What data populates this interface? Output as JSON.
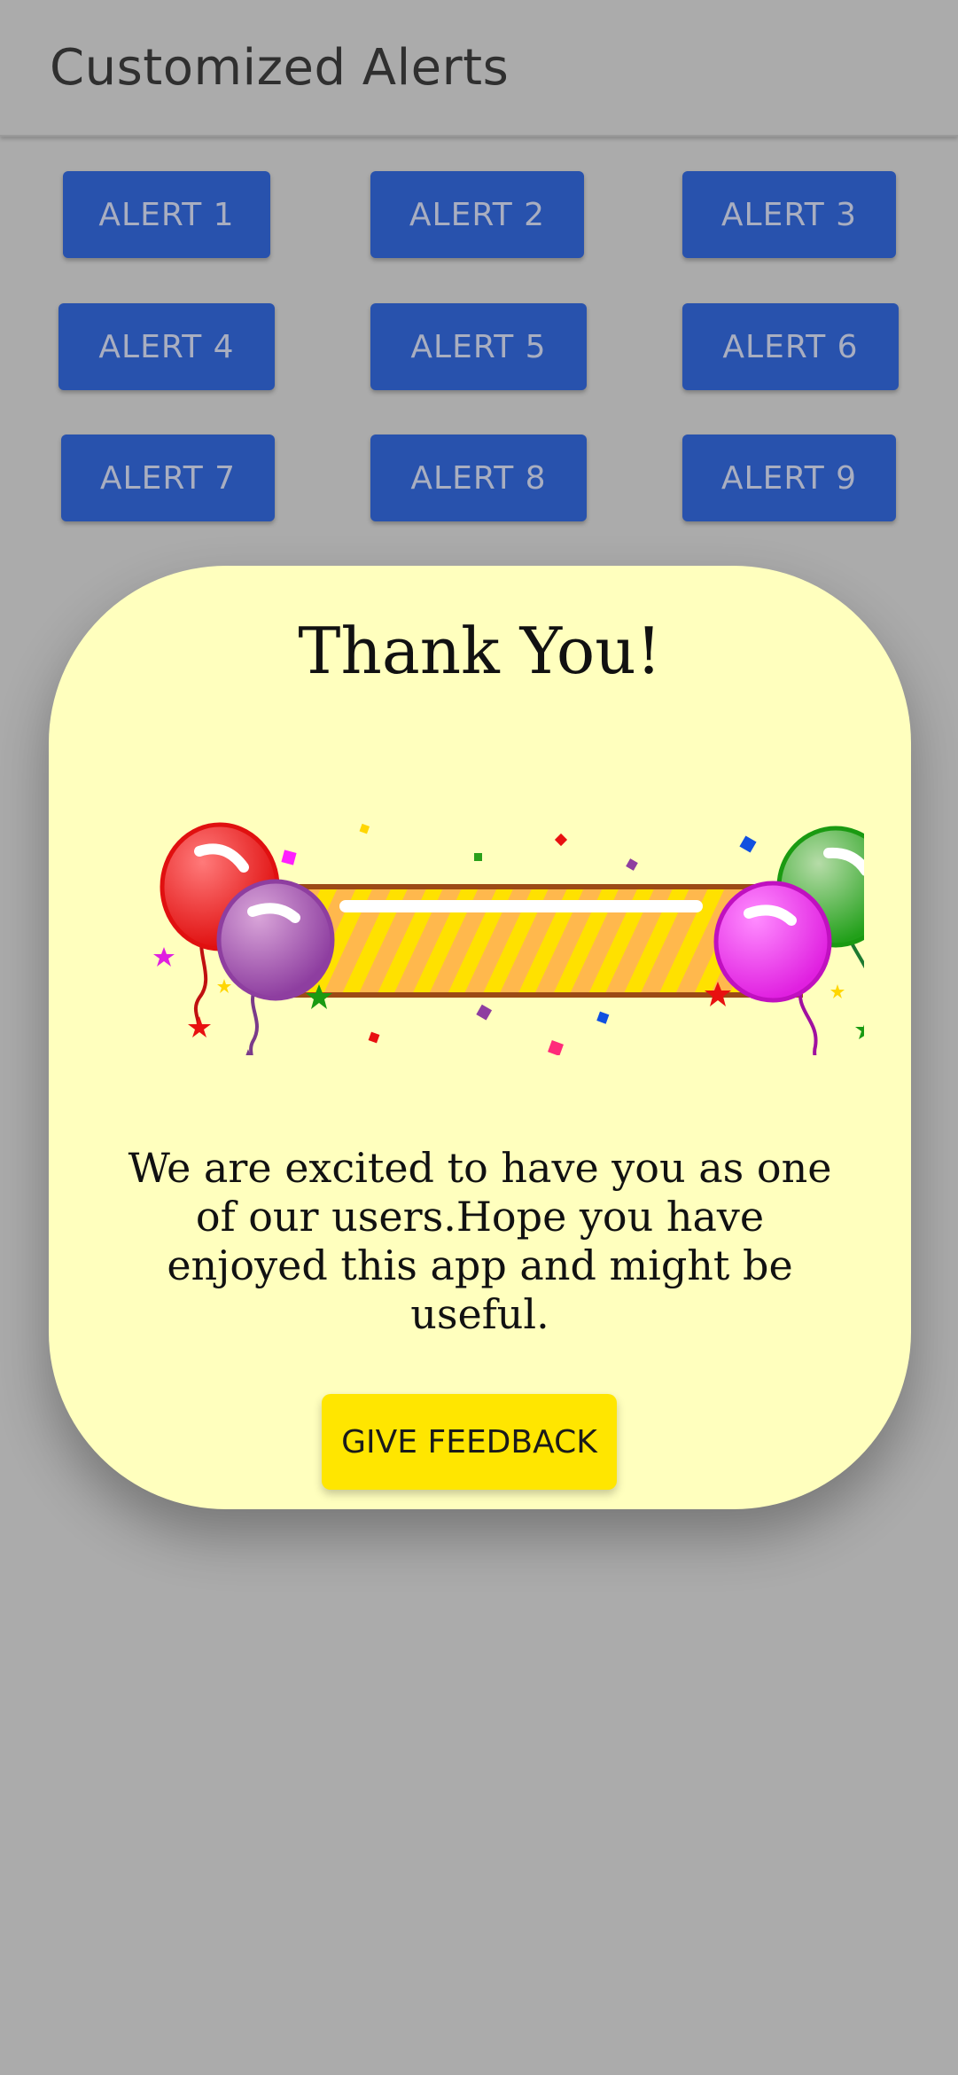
{
  "app_bar": {
    "title": "Customized Alerts"
  },
  "alerts": [
    {
      "label": "ALERT 1"
    },
    {
      "label": "ALERT 2"
    },
    {
      "label": "ALERT 3"
    },
    {
      "label": "ALERT 4"
    },
    {
      "label": "ALERT 5"
    },
    {
      "label": "ALERT 6"
    },
    {
      "label": "ALERT 7"
    },
    {
      "label": "ALERT 8"
    },
    {
      "label": "ALERT 9"
    }
  ],
  "dialog": {
    "title": "Thank You!",
    "image_icon": "balloons-celebration-banner",
    "message": "We are excited to have you as one of our users.Hope you have enjoyed this app and might be useful.",
    "button_label": "GIVE FEEDBACK"
  },
  "colors": {
    "background": "#ababab",
    "alert_button": "#2852ad",
    "alert_text": "#a9aec0",
    "dialog_background": "#ffffbe",
    "feedback_button": "#ffe600"
  }
}
